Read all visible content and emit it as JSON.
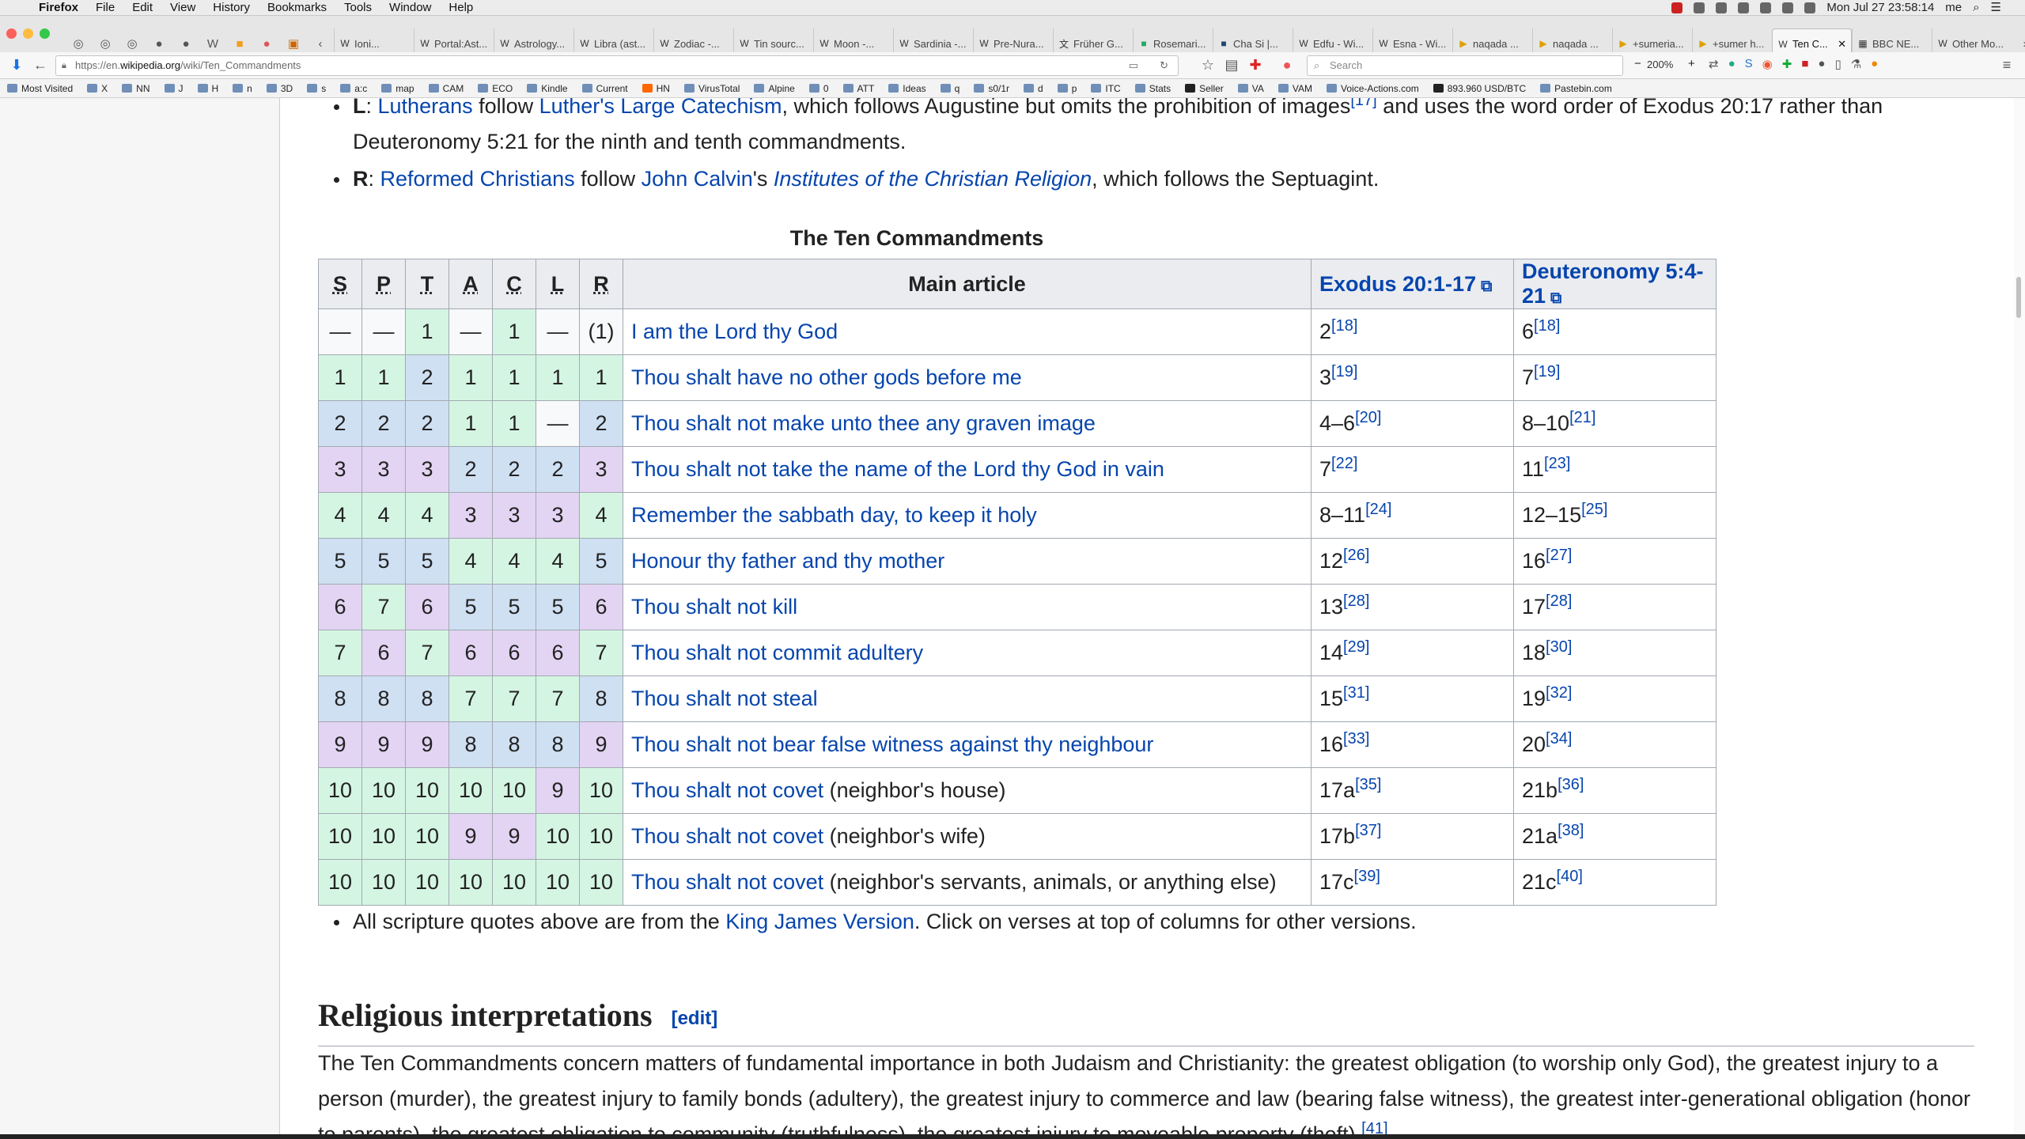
{
  "menubar": {
    "app": "Firefox",
    "items": [
      "File",
      "Edit",
      "View",
      "History",
      "Bookmarks",
      "Tools",
      "Window",
      "Help"
    ],
    "clock": "Mon Jul 27  23:58:14",
    "user": "me"
  },
  "tabs": [
    {
      "label": "Ioni..."
    },
    {
      "label": "Portal:Ast..."
    },
    {
      "label": "Astrology..."
    },
    {
      "label": "Libra (ast..."
    },
    {
      "label": "Zodiac -..."
    },
    {
      "label": "Tin sourc..."
    },
    {
      "label": "Moon -..."
    },
    {
      "label": "Sardinia -..."
    },
    {
      "label": "Pre-Nura..."
    },
    {
      "label": "Früher G..."
    },
    {
      "label": "Rosemari..."
    },
    {
      "label": "Cha Si |..."
    },
    {
      "label": "Edfu - Wi..."
    },
    {
      "label": "Esna - Wi..."
    },
    {
      "label": "naqada ..."
    },
    {
      "label": "naqada ..."
    },
    {
      "label": "+sumeria..."
    },
    {
      "label": "+sumer h..."
    },
    {
      "label": "Ten C..."
    },
    {
      "label": "BBC NE..."
    },
    {
      "label": "Other Mo..."
    }
  ],
  "nav": {
    "url_prefix": "https://en.",
    "url_domain": "wikipedia.org",
    "url_path": "/wiki/Ten_Commandments",
    "search_placeholder": "Search",
    "zoom": "200%"
  },
  "bookmarks": [
    "Most Visited",
    "X",
    "NN",
    "J",
    "H",
    "n",
    "3D",
    "s",
    "a:c",
    "map",
    "CAM",
    "ECO",
    "Kindle",
    "Current",
    "HN",
    "VirusTotal",
    "Alpine",
    "0",
    "ATT",
    "Ideas",
    "q",
    "s0/1r",
    "d",
    "p",
    "ITC",
    "Stats",
    "Seller",
    "VA",
    "VAM",
    "Voice-Actions.com",
    "893.960 USD/BTC",
    "Pastebin.com"
  ],
  "article": {
    "bullet_L": {
      "key": "L",
      "sep": ": ",
      "link1": "Lutherans",
      "t1": " follow ",
      "link2": "Luther's Large Catechism",
      "t2": ", which follows Augustine but omits the prohibition of images",
      "ref": "[17]",
      "t3": " and uses the word order of Exodus 20:17 rather than Deuteronomy 5:21 for the ninth and tenth commandments."
    },
    "bullet_R": {
      "key": "R",
      "sep": ": ",
      "link1": "Reformed Christians",
      "t1": " follow ",
      "link2": "John Calvin",
      "t2": "'s ",
      "link3": "Institutes of the Christian Religion",
      "t3": ", which follows the Septuagint."
    },
    "table_caption": "The Ten Commandments",
    "headers": [
      "S",
      "P",
      "T",
      "A",
      "C",
      "L",
      "R",
      "Main article",
      "Exodus 20:1-17",
      "Deuteronomy 5:4-21"
    ],
    "rows": [
      {
        "nums": [
          "—",
          "—",
          "1",
          "—",
          "1",
          "—",
          "(1)"
        ],
        "colors": [
          "w",
          "w",
          "g",
          "w",
          "g",
          "w",
          "w"
        ],
        "link": "I am the Lord thy God",
        "extra": "",
        "exo": "2",
        "exo_ref": "[18]",
        "deu": "6",
        "deu_ref": "[18]"
      },
      {
        "nums": [
          "1",
          "1",
          "2",
          "1",
          "1",
          "1",
          "1"
        ],
        "colors": [
          "g",
          "g",
          "b",
          "g",
          "g",
          "g",
          "g"
        ],
        "link": "Thou shalt have no other gods before me",
        "extra": "",
        "exo": "3",
        "exo_ref": "[19]",
        "deu": "7",
        "deu_ref": "[19]"
      },
      {
        "nums": [
          "2",
          "2",
          "2",
          "1",
          "1",
          "—",
          "2"
        ],
        "colors": [
          "b",
          "b",
          "b",
          "g",
          "g",
          "w",
          "b"
        ],
        "link": "Thou shalt not make unto thee any graven image",
        "extra": "",
        "exo": "4–6",
        "exo_ref": "[20]",
        "deu": "8–10",
        "deu_ref": "[21]"
      },
      {
        "nums": [
          "3",
          "3",
          "3",
          "2",
          "2",
          "2",
          "3"
        ],
        "colors": [
          "p",
          "p",
          "p",
          "b",
          "b",
          "b",
          "p"
        ],
        "link": "Thou shalt not take the name of the Lord thy God in vain",
        "extra": "",
        "exo": "7",
        "exo_ref": "[22]",
        "deu": "11",
        "deu_ref": "[23]"
      },
      {
        "nums": [
          "4",
          "4",
          "4",
          "3",
          "3",
          "3",
          "4"
        ],
        "colors": [
          "g",
          "g",
          "g",
          "p",
          "p",
          "p",
          "g"
        ],
        "link": "Remember the sabbath day, to keep it holy",
        "extra": "",
        "exo": "8–11",
        "exo_ref": "[24]",
        "deu": "12–15",
        "deu_ref": "[25]"
      },
      {
        "nums": [
          "5",
          "5",
          "5",
          "4",
          "4",
          "4",
          "5"
        ],
        "colors": [
          "b",
          "b",
          "b",
          "g",
          "g",
          "g",
          "b"
        ],
        "link": "Honour thy father and thy mother",
        "extra": "",
        "exo": "12",
        "exo_ref": "[26]",
        "deu": "16",
        "deu_ref": "[27]"
      },
      {
        "nums": [
          "6",
          "7",
          "6",
          "5",
          "5",
          "5",
          "6"
        ],
        "colors": [
          "p",
          "g",
          "p",
          "b",
          "b",
          "b",
          "p"
        ],
        "link": "Thou shalt not kill",
        "extra": "",
        "exo": "13",
        "exo_ref": "[28]",
        "deu": "17",
        "deu_ref": "[28]"
      },
      {
        "nums": [
          "7",
          "6",
          "7",
          "6",
          "6",
          "6",
          "7"
        ],
        "colors": [
          "g",
          "p",
          "g",
          "p",
          "p",
          "p",
          "g"
        ],
        "link": "Thou shalt not commit adultery",
        "extra": "",
        "exo": "14",
        "exo_ref": "[29]",
        "deu": "18",
        "deu_ref": "[30]"
      },
      {
        "nums": [
          "8",
          "8",
          "8",
          "7",
          "7",
          "7",
          "8"
        ],
        "colors": [
          "b",
          "b",
          "b",
          "g",
          "g",
          "g",
          "b"
        ],
        "link": "Thou shalt not steal",
        "extra": "",
        "exo": "15",
        "exo_ref": "[31]",
        "deu": "19",
        "deu_ref": "[32]"
      },
      {
        "nums": [
          "9",
          "9",
          "9",
          "8",
          "8",
          "8",
          "9"
        ],
        "colors": [
          "p",
          "p",
          "p",
          "b",
          "b",
          "b",
          "p"
        ],
        "link": "Thou shalt not bear false witness against thy neighbour",
        "extra": "",
        "exo": "16",
        "exo_ref": "[33]",
        "deu": "20",
        "deu_ref": "[34]"
      },
      {
        "nums": [
          "10",
          "10",
          "10",
          "10",
          "10",
          "9",
          "10"
        ],
        "colors": [
          "g",
          "g",
          "g",
          "g",
          "g",
          "p",
          "g"
        ],
        "link": "Thou shalt not covet",
        "extra": " (neighbor's house)",
        "exo": "17a",
        "exo_ref": "[35]",
        "deu": "21b",
        "deu_ref": "[36]"
      },
      {
        "nums": [
          "10",
          "10",
          "10",
          "9",
          "9",
          "10",
          "10"
        ],
        "colors": [
          "g",
          "g",
          "g",
          "p",
          "p",
          "g",
          "g"
        ],
        "link": "Thou shalt not covet",
        "extra": " (neighbor's wife)",
        "exo": "17b",
        "exo_ref": "[37]",
        "deu": "21a",
        "deu_ref": "[38]"
      },
      {
        "nums": [
          "10",
          "10",
          "10",
          "10",
          "10",
          "10",
          "10"
        ],
        "colors": [
          "g",
          "g",
          "g",
          "g",
          "g",
          "g",
          "g"
        ],
        "link": "Thou shalt not covet",
        "extra": " (neighbor's servants, animals, or anything else)",
        "exo": "17c",
        "exo_ref": "[39]",
        "deu": "21c",
        "deu_ref": "[40]"
      }
    ],
    "note": {
      "t1": "All scripture quotes above are from the ",
      "link": "King James Version",
      "t2": ". Click on verses at top of columns for other versions."
    },
    "section_title": "Religious interpretations",
    "edit_label": "[edit]",
    "paragraph": "The Ten Commandments concern matters of fundamental importance in both Judaism and Christianity: the greatest obligation (to worship only God), the greatest injury to a person (murder), the greatest injury to family bonds (adultery), the greatest injury to commerce and law (bearing false witness), the greatest inter-generational obligation (honor to parents), the greatest obligation to community (truthfulness), the greatest injury to moveable property (theft).",
    "paragraph_ref": "[41]"
  },
  "colors": {
    "green": "#d5f5e3",
    "blue": "#cfe0f3",
    "purple": "#e3d4f3",
    "link": "#0645ad"
  }
}
